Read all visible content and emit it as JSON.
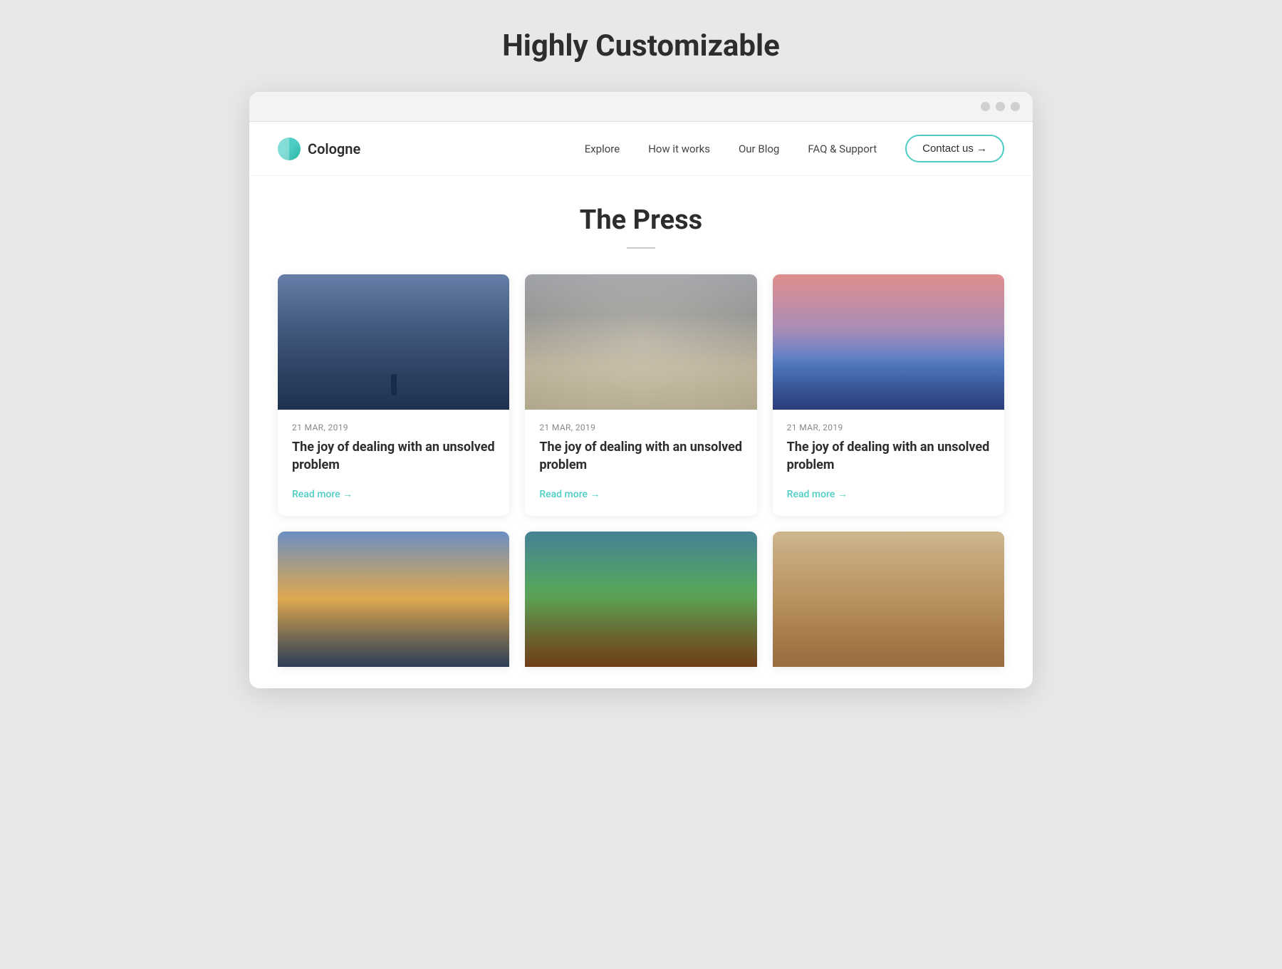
{
  "page": {
    "title": "Highly Customizable"
  },
  "navbar": {
    "logo_text": "Cologne",
    "links": [
      {
        "id": "explore",
        "label": "Explore"
      },
      {
        "id": "how-it-works",
        "label": "How it works"
      },
      {
        "id": "our-blog",
        "label": "Our Blog"
      },
      {
        "id": "faq",
        "label": "FAQ & Support"
      }
    ],
    "contact_button": "Contact us →"
  },
  "section": {
    "title": "The Press"
  },
  "cards": [
    {
      "id": "card-1",
      "date": "21 MAR, 2019",
      "title": "The joy of dealing with an unsolved problem",
      "read_more": "Read more →",
      "img_class": "card-img-1"
    },
    {
      "id": "card-2",
      "date": "21 MAR, 2019",
      "title": "The joy of dealing with an unsolved problem",
      "read_more": "Read more →",
      "img_class": "card-img-2"
    },
    {
      "id": "card-3",
      "date": "21 MAR, 2019",
      "title": "The joy of dealing with an unsolved problem",
      "read_more": "Read more →",
      "img_class": "card-img-3"
    }
  ],
  "partial_cards": [
    {
      "id": "card-4",
      "img_class": "card-img-4"
    },
    {
      "id": "card-5",
      "img_class": "card-img-5"
    },
    {
      "id": "card-6",
      "img_class": "card-img-6"
    }
  ],
  "colors": {
    "accent": "#4ecdc4",
    "text_dark": "#2d2d2d",
    "text_muted": "#888"
  }
}
